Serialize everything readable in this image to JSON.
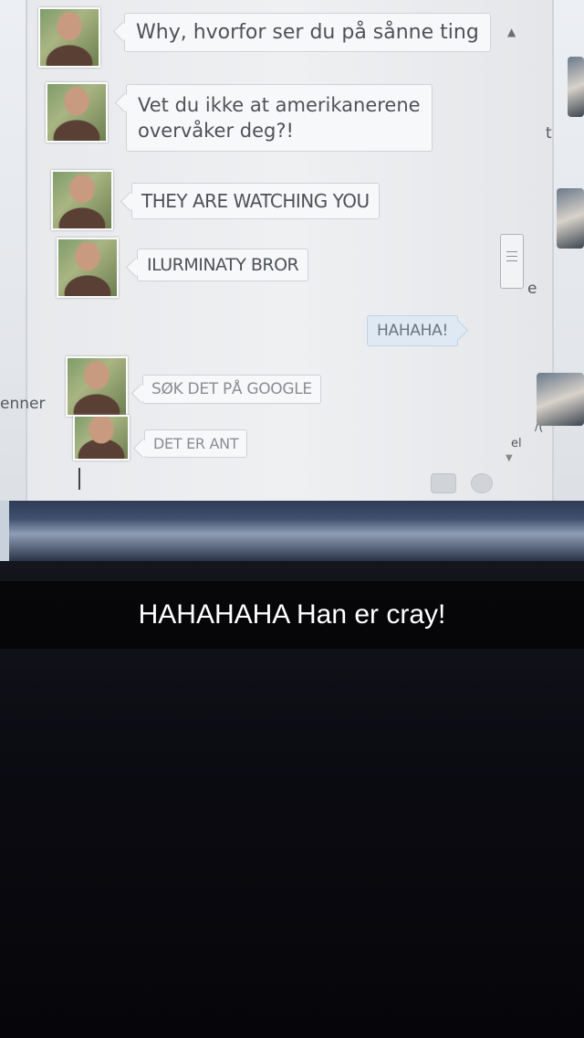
{
  "chat": {
    "messages": [
      {
        "sender": "friend",
        "text": "Why, hvorfor ser du på sånne ting"
      },
      {
        "sender": "friend",
        "lines": [
          "Vet du ikke at amerikanerene",
          "overvåker deg?!"
        ]
      },
      {
        "sender": "friend",
        "text": "THEY ARE WATCHING YOU"
      },
      {
        "sender": "friend",
        "text": "ILURMINATY BROR"
      },
      {
        "sender": "me",
        "text": "HAHAHA!"
      },
      {
        "sender": "friend",
        "text": "SØK DET PÅ GOOGLE"
      },
      {
        "sender": "friend",
        "text": "DET ER ANT"
      }
    ]
  },
  "sidebar": {
    "left_fragment": "enner",
    "right_fragments": [
      "t",
      "e",
      "/(",
      "el"
    ]
  },
  "icons": {
    "scroll_up": "triangle-up",
    "scroll_down": "triangle-down",
    "camera": "camera-icon",
    "emoji": "emoji-icon"
  },
  "snap": {
    "caption": "HAHAHAHA Han er cray!"
  },
  "colors": {
    "bubble_friend": "#f7f8f9",
    "bubble_me": "#dfe9f3",
    "caption_bar": "rgba(0,0,0,0.62)"
  }
}
